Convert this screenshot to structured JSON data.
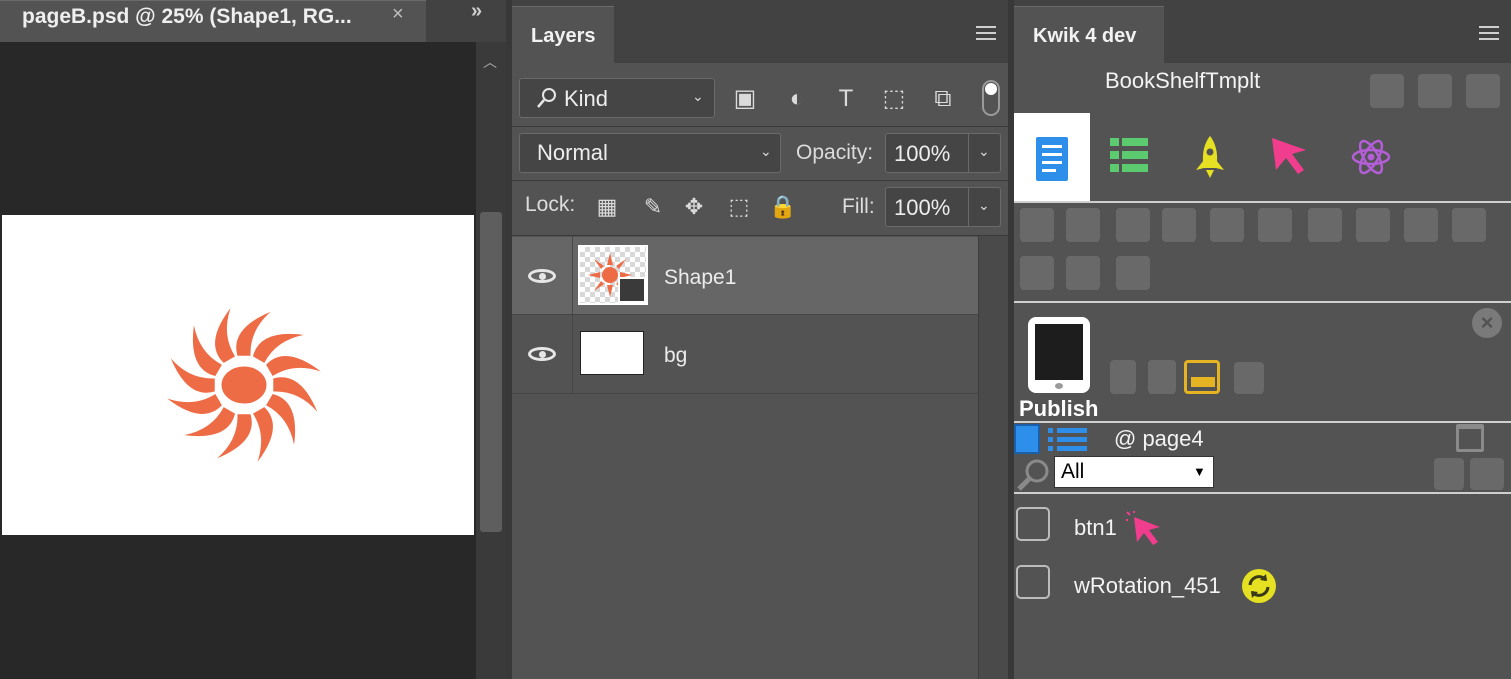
{
  "document": {
    "tab_title": "pageB.psd @ 25% (Shape1, RG...",
    "close_glyph": "×",
    "collapse_glyph": "»",
    "scroll_up_glyph": "︿",
    "sun_color": "#EE6C45"
  },
  "layers_panel": {
    "tab_label": "Layers",
    "filter_kind": "Kind",
    "blend_mode": "Normal",
    "opacity_label": "Opacity:",
    "opacity_value": "100%",
    "lock_label": "Lock:",
    "fill_label": "Fill:",
    "fill_value": "100%",
    "filter_icons": [
      "image-filter-icon",
      "adjustment-filter-icon",
      "type-filter-icon",
      "shape-filter-icon",
      "smart-object-filter-icon"
    ],
    "filter_glyphs": [
      "▣",
      "◐",
      "T",
      "⬚",
      "⧉"
    ],
    "lock_icons": [
      "lock-transparent-icon",
      "lock-brush-icon",
      "lock-position-icon",
      "lock-artboard-icon",
      "lock-all-icon"
    ],
    "lock_glyphs": [
      "▦",
      "✎",
      "✥",
      "⬚",
      "🔒"
    ],
    "layers": [
      {
        "name": "Shape1",
        "selected": true
      },
      {
        "name": "bg",
        "selected": false
      }
    ]
  },
  "kwik_panel": {
    "tab_label": "Kwik 4 dev",
    "project_name": "BookShelfTmplt",
    "publish_label": "Publish",
    "page_label": "@ page4",
    "filter_value": "All",
    "filter_arrow": "▼",
    "accent_colors": {
      "blue": "#2E8FEA",
      "green": "#5CCB70",
      "yellow": "#E6E022",
      "pink": "#F03D8E",
      "purple": "#B45ED8"
    },
    "items": [
      {
        "name": "btn1",
        "icon": "pointer-icon"
      },
      {
        "name": "wRotation_451",
        "icon": "rotation-icon"
      }
    ]
  }
}
